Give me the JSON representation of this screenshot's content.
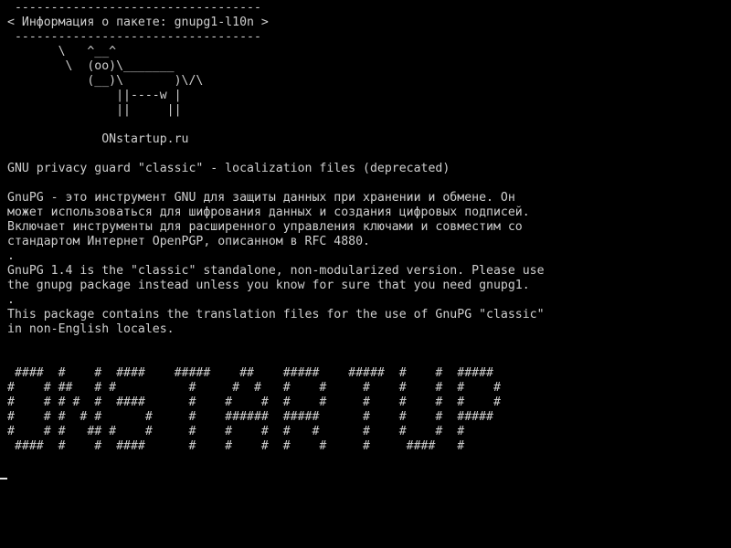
{
  "terminal": {
    "lines": [
      " ----------------------------------",
      "< Информация о пакете: gnupg1-l10n >",
      " ----------------------------------",
      "       \\   ^__^",
      "        \\  (oo)\\_______",
      "           (__)\\       )\\/\\",
      "               ||----w |",
      "               ||     ||",
      "",
      "             ONstartup.ru",
      "",
      "GNU privacy guard \"classic\" - localization files (deprecated)",
      "",
      "GnuPG - это инструмент GNU для защиты данных при хранении и обмене. Он",
      "может использоваться для шифрования данных и создания цифровых подписей.",
      "Включает инструменты для расширенного управления ключами и совместим со",
      "стандартом Интернет OpenPGP, описанном в RFC 4880.",
      ".",
      "GnuPG 1.4 is the \"classic\" standalone, non-modularized version. Please use",
      "the gnupg package instead unless you know for sure that you need gnupg1.",
      ".",
      "This package contains the translation files for the use of GnuPG \"classic\"",
      "in non-English locales.",
      "",
      "",
      " ####  #    #  ####    #####    ##    #####    #####  #    #  #####",
      "#    # ##   # #          #     #  #   #    #     #    #    #  #    #",
      "#    # # #  #  ####      #    #    #  #    #     #    #    #  #    #",
      "#    # #  # #      #     #    ######  #####      #    #    #  #####",
      "#    # #   ## #    #     #    #    #  #   #      #    #    #  #",
      " ####  #    #  ####      #    #    #  #    #     #     ####   #"
    ]
  }
}
